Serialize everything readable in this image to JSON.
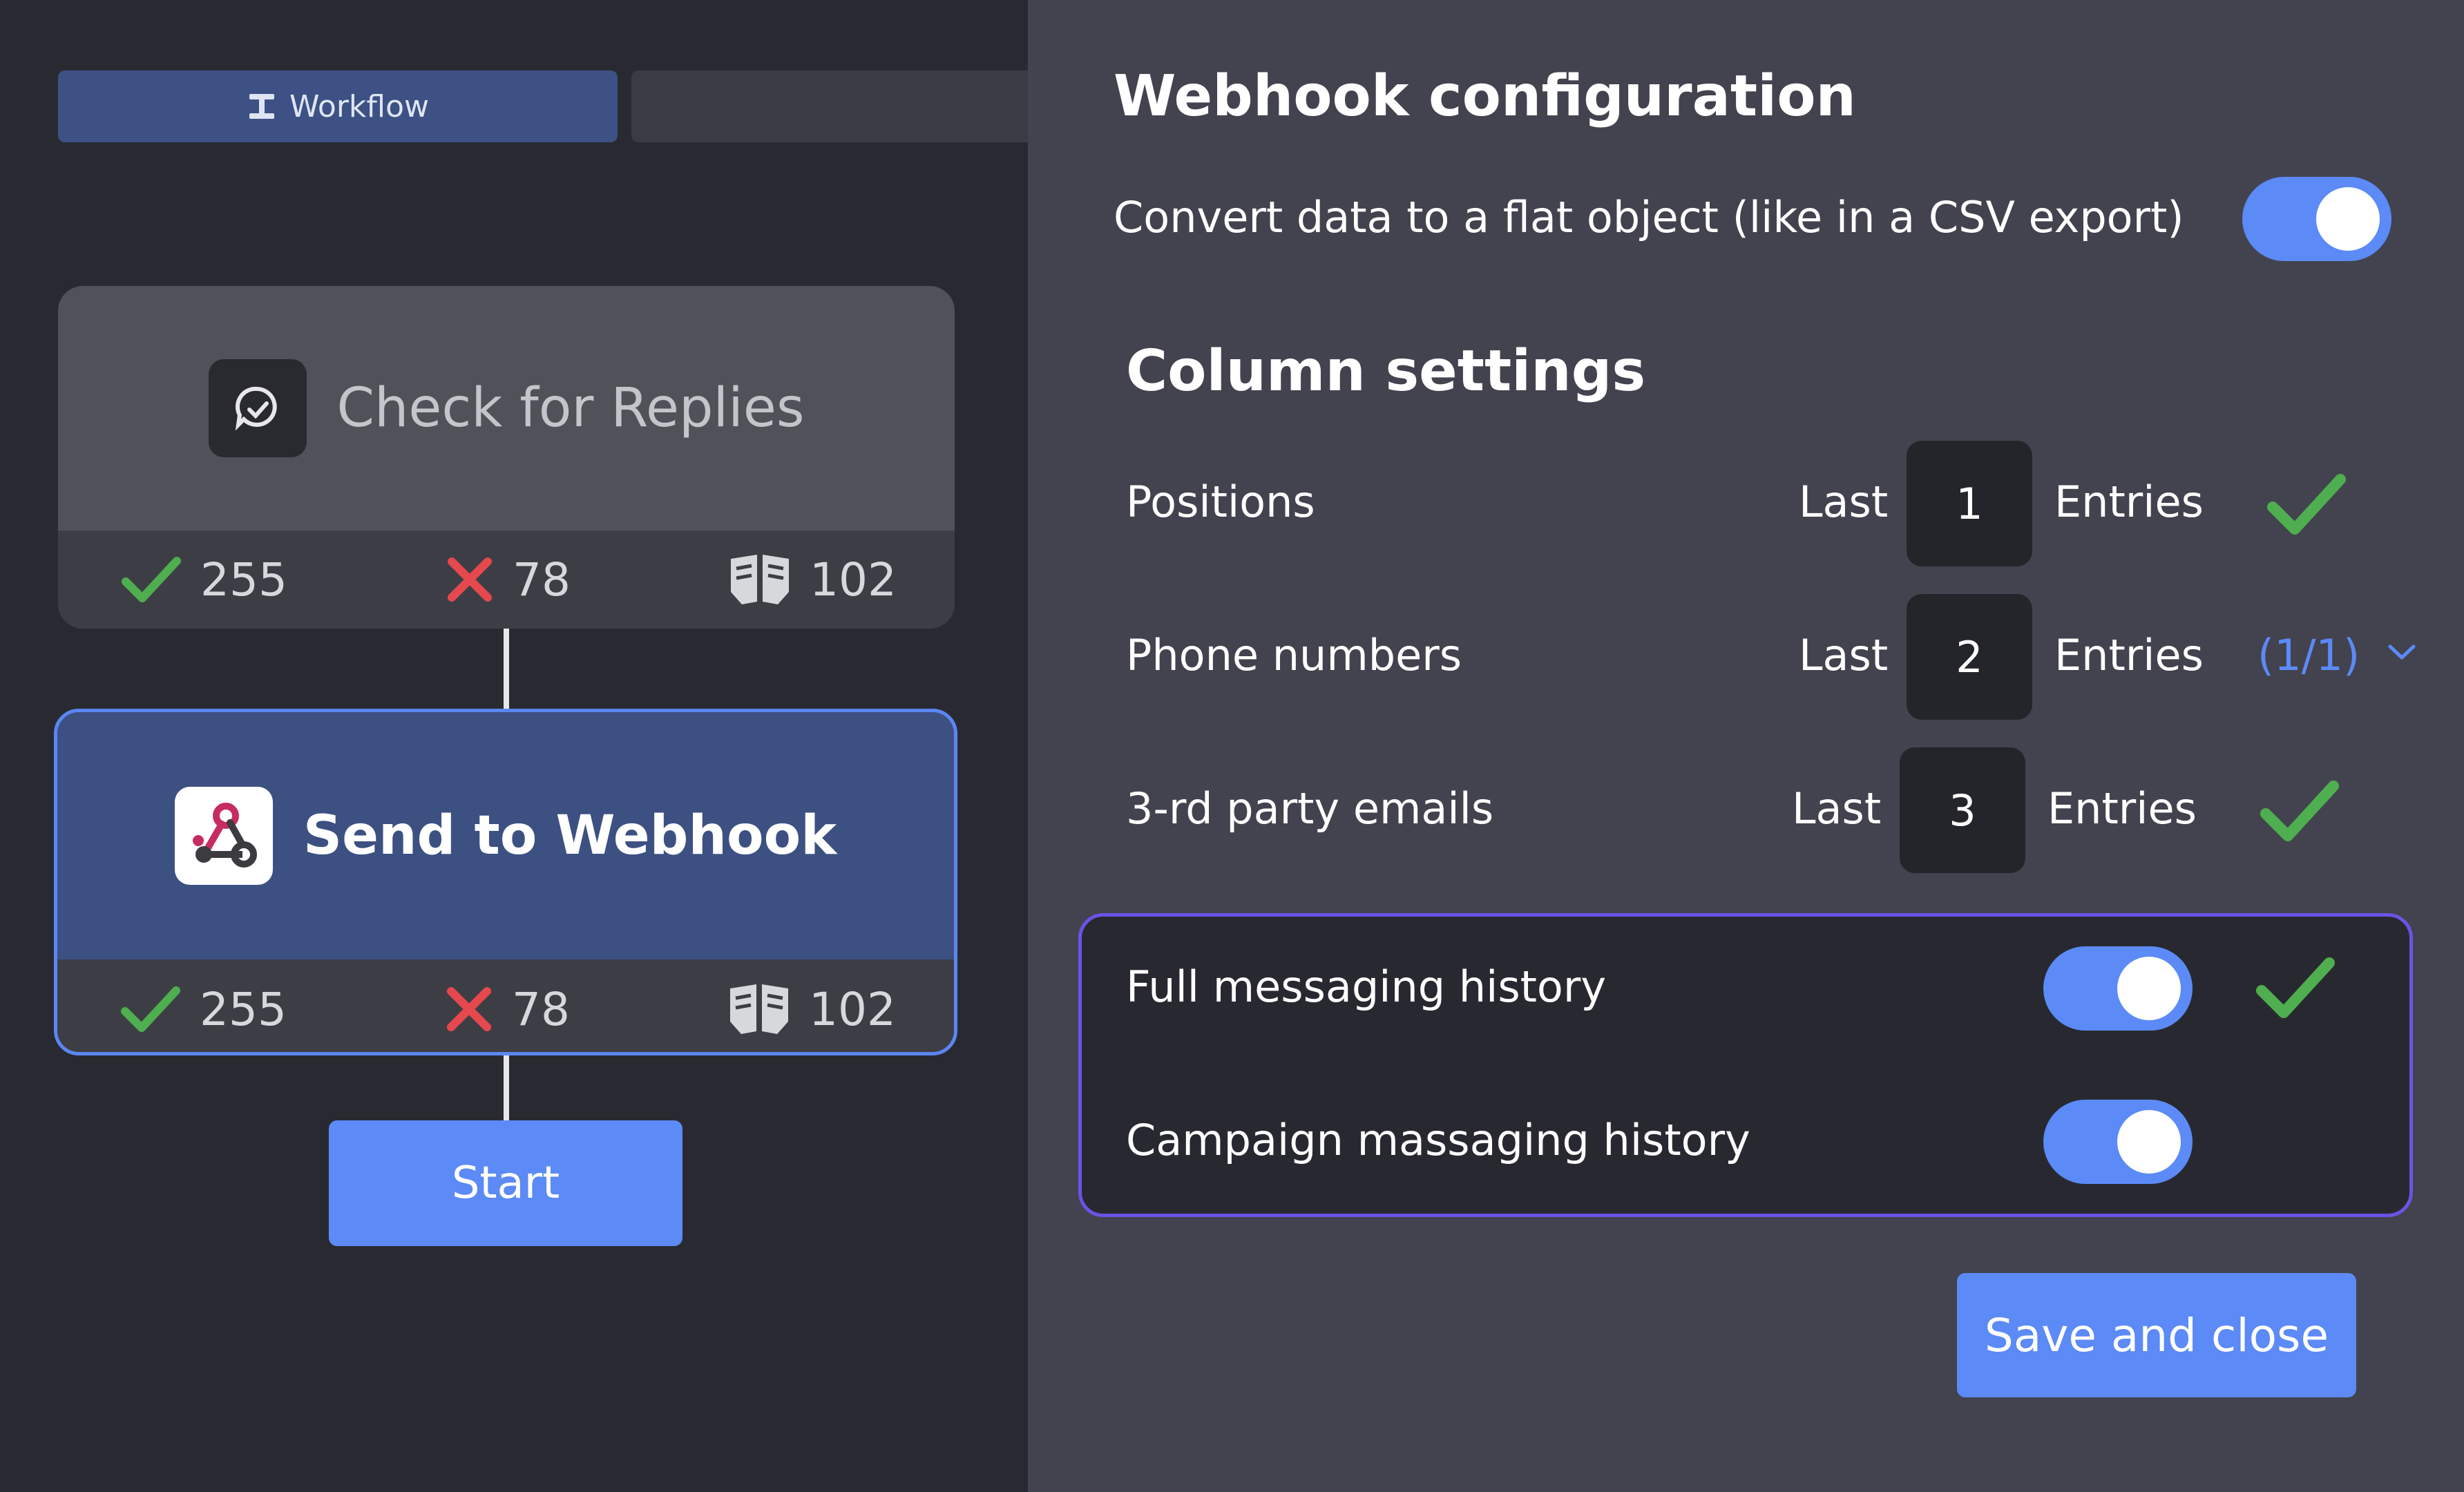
{
  "tabs": {
    "workflow_label": "Workflow"
  },
  "workflow": {
    "nodes": [
      {
        "title": "Check for Replies",
        "stats": {
          "success": "255",
          "failed": "78",
          "skipped": "102"
        }
      },
      {
        "title": "Send to Webhook",
        "stats": {
          "success": "255",
          "failed": "78",
          "skipped": "102"
        }
      }
    ],
    "start_label": "Start"
  },
  "config": {
    "title": "Webhook configuration",
    "flat_object_label": "Convert data to a flat object (like in a CSV export)",
    "flat_object_enabled": true,
    "column_settings_title": "Column settings",
    "rows": [
      {
        "label": "Positions",
        "prefix": "Last",
        "value": "1",
        "suffix": "Entries"
      },
      {
        "label": "Phone numbers",
        "prefix": "Last",
        "value": "2",
        "suffix": "Entries",
        "counter": "(1/1)"
      },
      {
        "label": "3-rd party emails",
        "prefix": "Last",
        "value": "3",
        "suffix": "Entries"
      }
    ],
    "history": [
      {
        "label": "Full messaging history",
        "enabled": true
      },
      {
        "label": "Campaign massaging history",
        "enabled": true
      }
    ],
    "save_label": "Save and close"
  },
  "colors": {
    "accent": "#5c8af6",
    "success": "#4fae4f",
    "error": "#e5484d",
    "highlight_border": "#6b53e6"
  }
}
